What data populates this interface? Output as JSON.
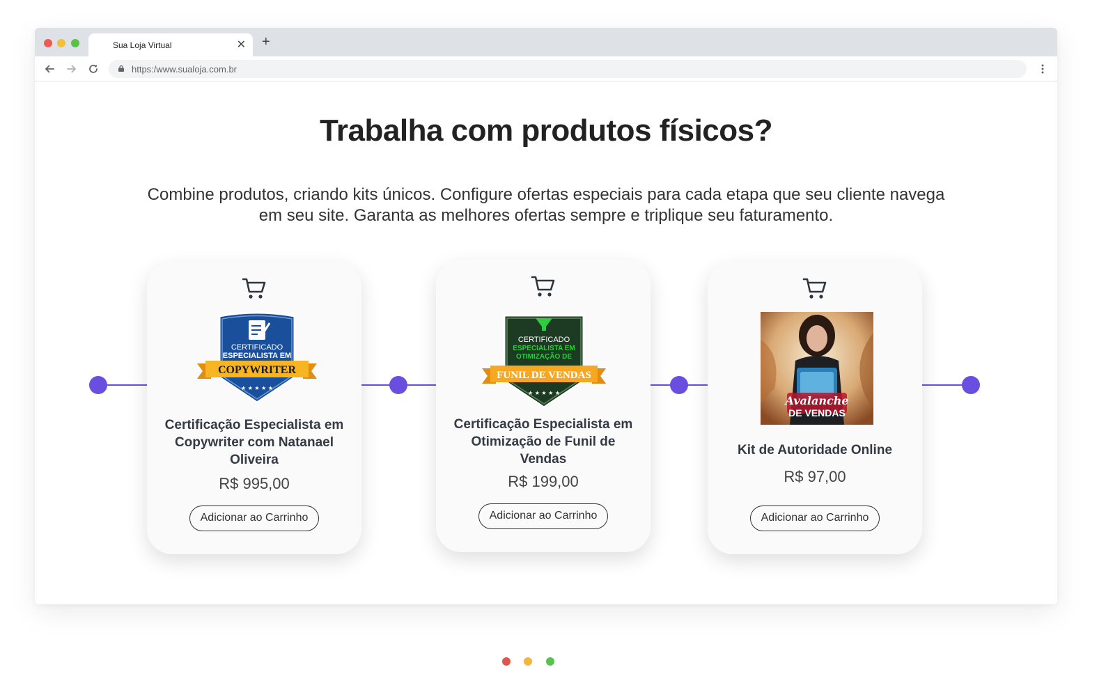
{
  "browser": {
    "tab_title": "Sua Loja Virtual",
    "url": "https:/www.sualoja.com.br",
    "window_dots": [
      "#ed5b52",
      "#f3bf3d",
      "#5ac148"
    ]
  },
  "hero": {
    "title": "Trabalha com produtos físicos?",
    "subtitle": "Combine produtos, criando kits únicos. Configure ofertas especiais para cada etapa que seu cliente navega em seu site. Garanta as melhores ofertas sempre e triplique seu faturamento."
  },
  "products": [
    {
      "title": "Certificação Especialista em Copywriter com Natanael Oliveira",
      "price": "R$ 995,00",
      "button": "Adicionar ao Carrinho",
      "image": {
        "kind": "badge-blue",
        "line1": "CERTIFICADO",
        "line2": "ESPECIALISTA EM",
        "ribbon": "COPYWRITER"
      }
    },
    {
      "title": "Certificação Especialista em Otimização de Funil de Vendas",
      "price": "R$ 199,00",
      "button": "Adicionar ao Carrinho",
      "image": {
        "kind": "badge-green",
        "line1": "CERTIFICADO",
        "line2": "ESPECIALISTA EM",
        "line3": "OTIMIZAÇÃO DE",
        "ribbon": "FUNIL DE VENDAS"
      }
    },
    {
      "title": "Kit de Autoridade Online",
      "price": "R$ 97,00",
      "button": "Adicionar ao Carrinho",
      "image": {
        "kind": "cover-photo",
        "logo_line1": "Avalanche",
        "logo_line2": "DE VENDAS"
      }
    }
  ],
  "colors": {
    "accent": "#6a4ee0",
    "heading": "#222222",
    "badge_blue": "#1a4f9c",
    "badge_green": "#1d3b22",
    "ribbon": "#f7a823"
  },
  "pagination_dots": [
    "#e0564b",
    "#f2b63b",
    "#55c34c"
  ]
}
